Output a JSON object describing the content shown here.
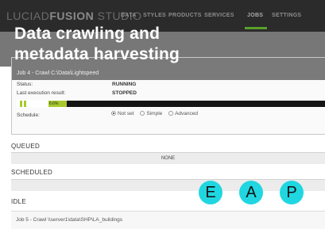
{
  "header": {
    "brand_part1": "LUCIAD",
    "brand_part2": "FUSION",
    "brand_part3": " STUDIO",
    "nav": [
      {
        "label": "DATA",
        "active": false
      },
      {
        "label": "STYLES",
        "active": false
      },
      {
        "label": "PRODUCTS",
        "active": false
      },
      {
        "label": "SERVICES",
        "active": false
      },
      {
        "label": "JOBS",
        "active": true
      },
      {
        "label": "SETTINGS",
        "active": false
      }
    ]
  },
  "hero": {
    "line1": "Data crawling and",
    "line2": "metadata harvesting"
  },
  "job": {
    "title": "Job 4 - Crawl C:\\Data\\Lightspeed",
    "status_label": "Status:",
    "status_value": "RUNNING",
    "last_result_label": "Last execution result:",
    "last_result_value": "STOPPED",
    "progress_label": "6.6%",
    "progress_fraction": 0.066,
    "schedule_label": "Schedule:",
    "schedule_options": [
      "Not set",
      "Simple",
      "Advanced"
    ],
    "schedule_selected": "Not set"
  },
  "queued": {
    "heading": "QUEUED",
    "empty_text": "NONE"
  },
  "scheduled": {
    "heading": "SCHEDULED"
  },
  "idle": {
    "heading": "IDLE",
    "item": "Job 5 - Crawl \\\\server1\\data\\SHP\\LA_buildings"
  },
  "badges": [
    "E",
    "A",
    "P"
  ],
  "colors": {
    "accent": "#a8c92c",
    "nav_active": "#5aa02c",
    "badge": "#20d6e0",
    "topbar": "#2b2b2b"
  }
}
